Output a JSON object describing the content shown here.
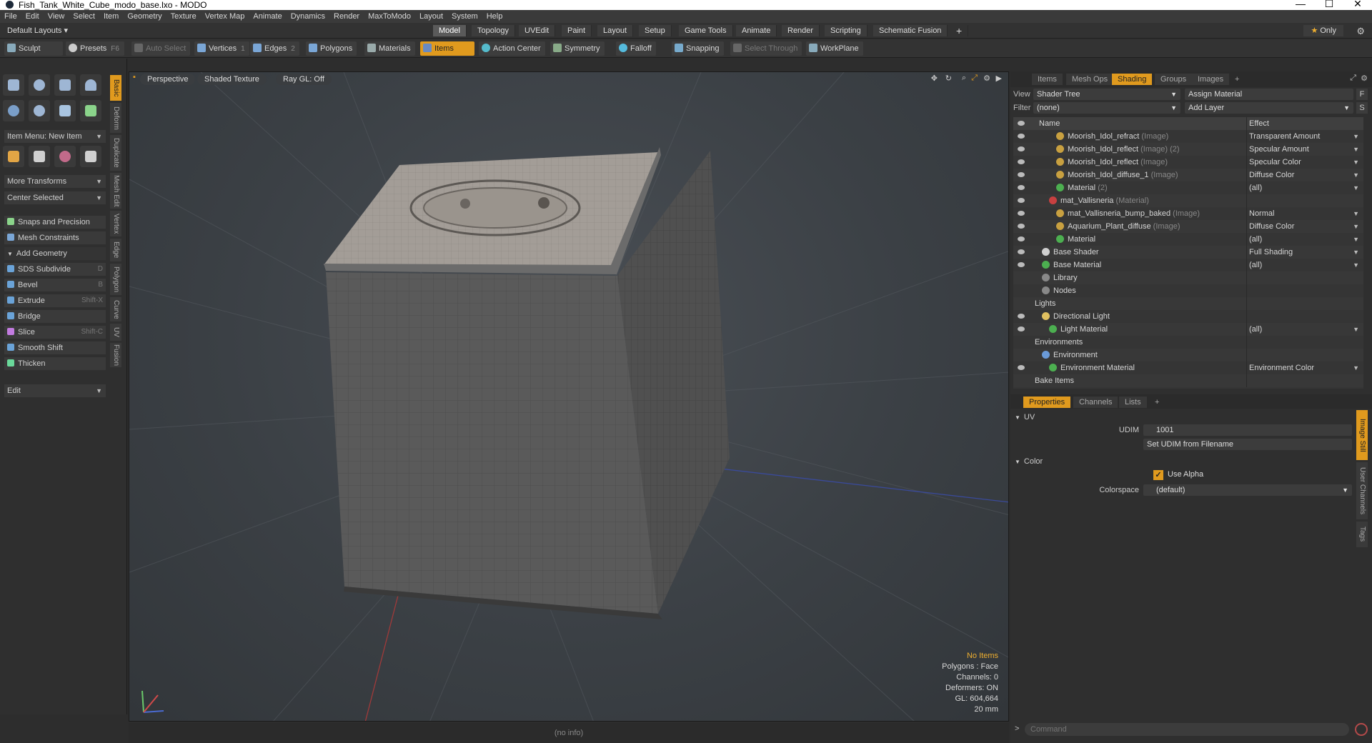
{
  "window": {
    "title": "Fish_Tank_White_Cube_modo_base.lxo - MODO",
    "controls": [
      "—",
      "☐",
      "✕"
    ]
  },
  "menu": [
    "File",
    "Edit",
    "View",
    "Select",
    "Item",
    "Geometry",
    "Texture",
    "Vertex Map",
    "Animate",
    "Dynamics",
    "Render",
    "MaxToModo",
    "Layout",
    "System",
    "Help"
  ],
  "layouts": {
    "default_label": "Default Layouts ▾",
    "tabs": [
      "Model",
      "Topology",
      "UVEdit",
      "Paint",
      "Layout",
      "Setup",
      "Game Tools",
      "Animate",
      "Render",
      "Scripting",
      "Schematic Fusion"
    ],
    "active": "Model",
    "add": "+",
    "only_label": "Only",
    "gear": "⚙"
  },
  "toolbar": {
    "sculpt": "Sculpt",
    "presets": "Presets",
    "presets_key": "F6",
    "auto_select": "Auto Select",
    "vertices": "Vertices",
    "vertices_key": "1",
    "edges": "Edges",
    "edges_key": "2",
    "polygons": "Polygons",
    "materials": "Materials",
    "items": "Items",
    "action_center": "Action Center",
    "symmetry": "Symmetry",
    "falloff": "Falloff",
    "snapping": "Snapping",
    "select_through": "Select Through",
    "workplane": "WorkPlane"
  },
  "left": {
    "item_menu": "Item Menu: New Item",
    "more_transforms": "More Transforms",
    "center_selected": "Center Selected",
    "snaps": "Snaps and Precision",
    "mesh_constraints": "Mesh Constraints",
    "add_geometry": "Add Geometry",
    "tools": [
      {
        "label": "SDS Subdivide",
        "key": "D",
        "color": "#6aa3d8"
      },
      {
        "label": "Bevel",
        "key": "B",
        "color": "#6aa3d8"
      },
      {
        "label": "Extrude",
        "key": "Shift-X",
        "color": "#6aa3d8"
      },
      {
        "label": "Bridge",
        "key": "",
        "color": "#6aa3d8"
      },
      {
        "label": "Slice",
        "key": "Shift-C",
        "color": "#c27be0"
      },
      {
        "label": "Smooth Shift",
        "key": "",
        "color": "#6aa3d8"
      },
      {
        "label": "Thicken",
        "key": "",
        "color": "#6ad89a"
      }
    ],
    "edit": "Edit",
    "vtabs": [
      "Basic",
      "Deform",
      "Duplicate",
      "Mesh Edit",
      "Vertex",
      "Edge",
      "Polygon",
      "Curve",
      "UV",
      "Fusion"
    ]
  },
  "viewport": {
    "perspective": "Perspective",
    "shading": "Shaded Texture",
    "raygl": "Ray GL: Off",
    "stats": {
      "no_items": "No Items",
      "polygons": "Polygons : Face",
      "channels": "Channels: 0",
      "deformers": "Deformers: ON",
      "gl": "GL: 604,664",
      "scale": "20 mm"
    },
    "status": "(no info)"
  },
  "shading_panel": {
    "tabs": [
      "Items",
      "Mesh Ops",
      "Shading",
      "Groups",
      "Images",
      "+"
    ],
    "active": "Shading",
    "view_label": "View",
    "view_value": "Shader Tree",
    "assign_material": "Assign Material",
    "filter_label": "Filter",
    "filter_value": "(none)",
    "add_layer": "Add Layer",
    "col_name": "Name",
    "col_effect": "Effect",
    "rows": [
      {
        "indent": 5,
        "name": "Moorish_Idol_refract",
        "sub": "(Image)",
        "effect": "Transparent Amount",
        "eye": true,
        "icon": "img"
      },
      {
        "indent": 5,
        "name": "Moorish_Idol_reflect",
        "sub": "(Image) (2)",
        "effect": "Specular Amount",
        "eye": true,
        "icon": "img"
      },
      {
        "indent": 5,
        "name": "Moorish_Idol_reflect",
        "sub": "(Image)",
        "effect": "Specular Color",
        "eye": true,
        "icon": "img"
      },
      {
        "indent": 5,
        "name": "Moorish_Idol_diffuse_1",
        "sub": "(Image)",
        "effect": "Diffuse Color",
        "eye": true,
        "icon": "img"
      },
      {
        "indent": 5,
        "name": "Material",
        "sub": "(2)",
        "effect": "(all)",
        "eye": true,
        "icon": "mat"
      },
      {
        "indent": 4,
        "name": "mat_Vallisneria",
        "sub": "(Material)",
        "effect": "",
        "eye": true,
        "icon": "red"
      },
      {
        "indent": 5,
        "name": "mat_Vallisneria_bump_baked",
        "sub": "(Image)",
        "effect": "Normal",
        "eye": true,
        "icon": "img"
      },
      {
        "indent": 5,
        "name": "Aquarium_Plant_diffuse",
        "sub": "(Image)",
        "effect": "Diffuse Color",
        "eye": true,
        "icon": "img"
      },
      {
        "indent": 5,
        "name": "Material",
        "sub": "",
        "effect": "(all)",
        "eye": true,
        "icon": "mat"
      },
      {
        "indent": 3,
        "name": "Base Shader",
        "sub": "",
        "effect": "Full Shading",
        "eye": true,
        "icon": "shader"
      },
      {
        "indent": 3,
        "name": "Base Material",
        "sub": "",
        "effect": "(all)",
        "eye": true,
        "icon": "mat"
      },
      {
        "indent": 3,
        "name": "Library",
        "sub": "",
        "effect": "",
        "eye": false,
        "icon": "folder"
      },
      {
        "indent": 3,
        "name": "Nodes",
        "sub": "",
        "effect": "",
        "eye": false,
        "icon": "folder"
      },
      {
        "indent": 2,
        "name": "Lights",
        "sub": "",
        "effect": "",
        "eye": false,
        "icon": "none"
      },
      {
        "indent": 3,
        "name": "Directional Light",
        "sub": "",
        "effect": "",
        "eye": true,
        "icon": "light"
      },
      {
        "indent": 4,
        "name": "Light Material",
        "sub": "",
        "effect": "(all)",
        "eye": true,
        "icon": "mat"
      },
      {
        "indent": 2,
        "name": "Environments",
        "sub": "",
        "effect": "",
        "eye": false,
        "icon": "none"
      },
      {
        "indent": 3,
        "name": "Environment",
        "sub": "",
        "effect": "",
        "eye": false,
        "icon": "env"
      },
      {
        "indent": 4,
        "name": "Environment Material",
        "sub": "",
        "effect": "Environment Color",
        "eye": true,
        "icon": "mat"
      },
      {
        "indent": 2,
        "name": "Bake Items",
        "sub": "",
        "effect": "",
        "eye": false,
        "icon": "none"
      }
    ]
  },
  "properties_panel": {
    "tabs": [
      "Properties",
      "Channels",
      "Lists",
      "+"
    ],
    "active": "Properties",
    "uv_section": "UV",
    "udim_label": "UDIM",
    "udim_value": "1001",
    "set_udim": "Set UDIM from Filename",
    "color_section": "Color",
    "use_alpha": "Use Alpha",
    "colorspace_label": "Colorspace",
    "colorspace_value": "(default)",
    "vtabs": [
      "Image Still",
      "User Channels",
      "Tags"
    ]
  },
  "command": {
    "prompt": ">",
    "placeholder": "Command"
  },
  "colors": {
    "accent": "#e09a1e"
  }
}
